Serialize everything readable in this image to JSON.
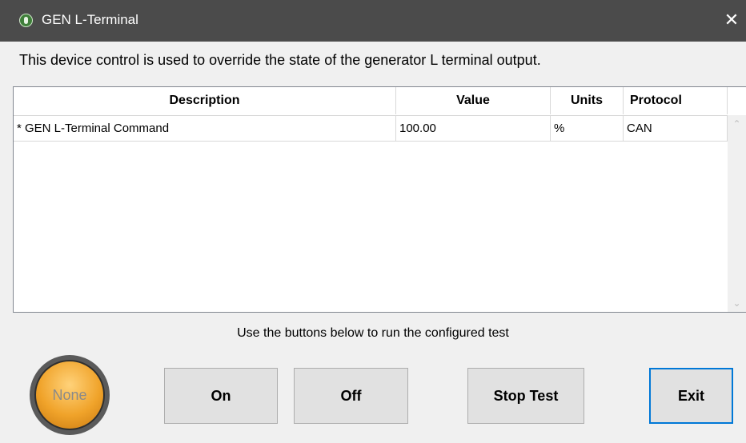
{
  "window": {
    "title": "GEN L-Terminal",
    "close_glyph": "✕"
  },
  "description": "This device control is used to override the state of the generator L terminal output.",
  "grid": {
    "columns": [
      "Description",
      "Value",
      "Units",
      "Protocol"
    ],
    "rows": [
      {
        "description": "* GEN L-Terminal Command",
        "value": "100.00",
        "units": "%",
        "protocol": "CAN"
      }
    ]
  },
  "instructions": "Use the buttons below to run the configured test",
  "status": {
    "label": "None",
    "color": "#f0a32a"
  },
  "buttons": {
    "on": "On",
    "off": "Off",
    "stop": "Stop Test",
    "exit": "Exit"
  },
  "icons": {
    "app": "app-logo-icon",
    "close": "close-icon",
    "scroll_up": "chevron-up-icon",
    "scroll_down": "chevron-down-icon"
  },
  "colors": {
    "titlebar": "#4b4b4b",
    "accent": "#0078d7",
    "background": "#f0f0f0"
  }
}
